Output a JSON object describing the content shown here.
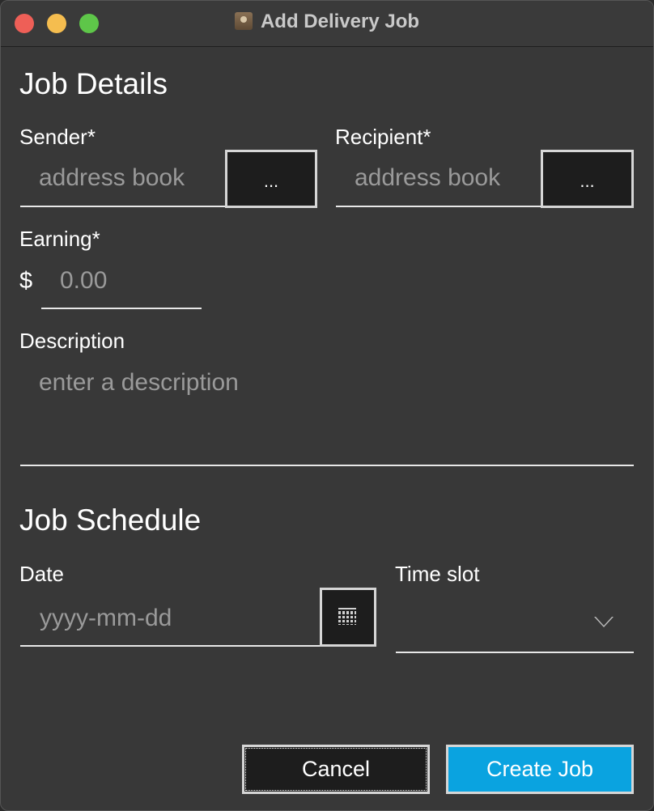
{
  "window": {
    "title": "Add Delivery Job"
  },
  "job_details": {
    "heading": "Job Details",
    "sender": {
      "label": "Sender*",
      "placeholder": "address book",
      "picker_label": "..."
    },
    "recipient": {
      "label": "Recipient*",
      "placeholder": "address book",
      "picker_label": "..."
    },
    "earning": {
      "label": "Earning*",
      "currency": "$",
      "placeholder": "0.00"
    },
    "description": {
      "label": "Description",
      "placeholder": "enter a description"
    }
  },
  "job_schedule": {
    "heading": "Job Schedule",
    "date": {
      "label": "Date",
      "placeholder": "yyyy-mm-dd"
    },
    "time_slot": {
      "label": "Time slot",
      "value": ""
    }
  },
  "actions": {
    "cancel_label": "Cancel",
    "create_label": "Create Job"
  },
  "colors": {
    "background": "#383838",
    "accent": "#0aa3e0",
    "traffic_close": "#ee5f57",
    "traffic_minimize": "#f5bd4f",
    "traffic_maximize": "#5ec649"
  }
}
